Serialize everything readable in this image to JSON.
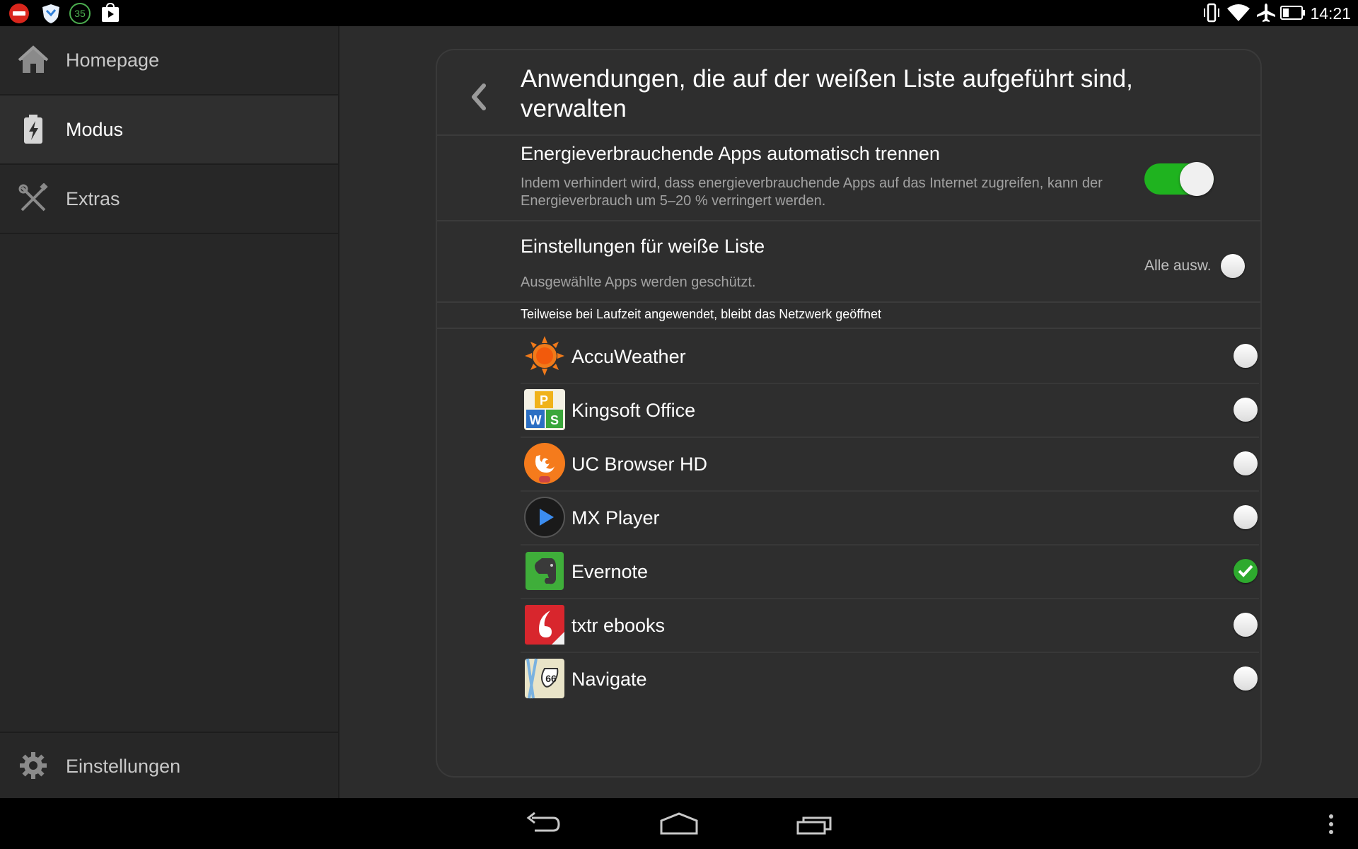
{
  "status_bar": {
    "time": "14:21",
    "notification_badge": "35",
    "left_icons": [
      "no-entry-icon",
      "shield-icon",
      "badge-35-icon",
      "store-icon"
    ],
    "right_icons": [
      "vibrate-icon",
      "wifi-icon",
      "airplane-icon",
      "battery-icon"
    ]
  },
  "sidebar": {
    "items": [
      {
        "label": "Homepage",
        "icon": "home-icon"
      },
      {
        "label": "Modus",
        "icon": "battery-mode-icon"
      },
      {
        "label": "Extras",
        "icon": "tools-icon"
      }
    ],
    "settings_label": "Einstellungen"
  },
  "page": {
    "title": "Anwendungen, die auf der weißen Liste aufgeführt sind, verwalten",
    "auto_disconnect": {
      "title": "Energieverbrauchende Apps automatisch trennen",
      "description": "Indem verhindert wird, dass energieverbrauchende Apps auf das Internet zugreifen, kann der Energieverbrauch um 5–20 % verringert werden.",
      "enabled": true
    },
    "whitelist": {
      "title": "Einstellungen für weiße Liste",
      "description": "Ausgewählte Apps werden geschützt.",
      "select_all_label": "Alle ausw.",
      "select_all_checked": false
    },
    "group_header": "Teilweise bei Laufzeit angewendet, bleibt das Netzwerk geöffnet",
    "apps": [
      {
        "name": "AccuWeather",
        "icon": "accuweather-icon",
        "checked": false
      },
      {
        "name": "Kingsoft Office",
        "icon": "kingsoft-office-icon",
        "checked": false
      },
      {
        "name": "UC Browser HD",
        "icon": "uc-browser-icon",
        "checked": false
      },
      {
        "name": "MX Player",
        "icon": "mx-player-icon",
        "checked": false
      },
      {
        "name": "Evernote",
        "icon": "evernote-icon",
        "checked": true
      },
      {
        "name": "txtr ebooks",
        "icon": "txtr-icon",
        "checked": false
      },
      {
        "name": "Navigate",
        "icon": "navigate-icon",
        "checked": false
      }
    ]
  },
  "colors": {
    "toggle_on": "#1fb31f",
    "check_on": "#2eaa2e",
    "sidebar_bg": "#272727",
    "main_bg": "#2c2c2c"
  }
}
